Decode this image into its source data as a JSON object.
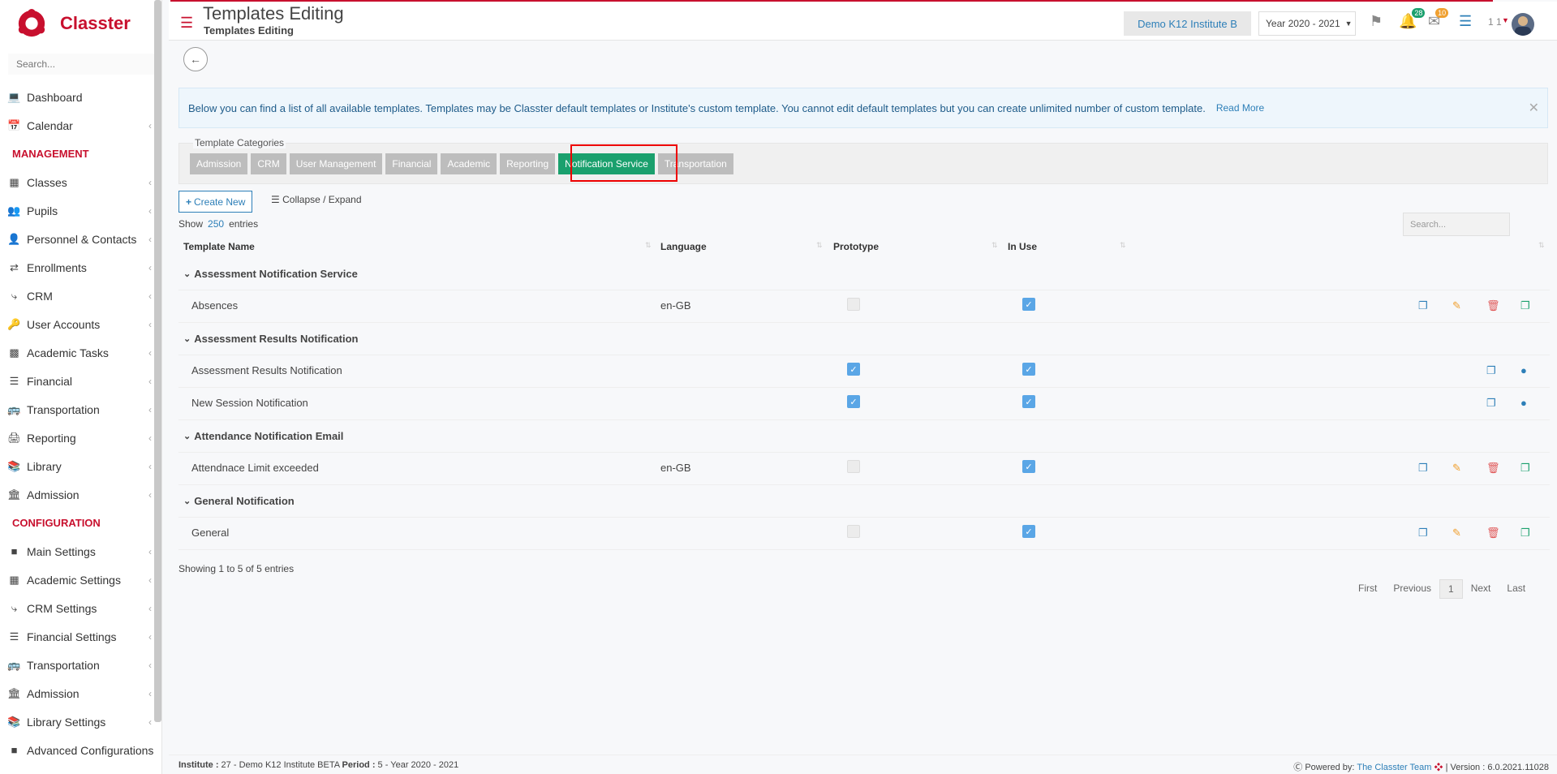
{
  "brand": "Classter",
  "sidebar": {
    "search_placeholder": "Search...",
    "items": [
      {
        "label": "Dashboard"
      },
      {
        "label": "Calendar"
      },
      {
        "label": "Classes"
      },
      {
        "label": "Pupils"
      },
      {
        "label": "Personnel & Contacts"
      },
      {
        "label": "Enrollments"
      },
      {
        "label": "CRM"
      },
      {
        "label": "User Accounts"
      },
      {
        "label": "Academic Tasks"
      },
      {
        "label": "Financial"
      },
      {
        "label": "Transportation"
      },
      {
        "label": "Reporting"
      },
      {
        "label": "Library"
      },
      {
        "label": "Admission"
      }
    ],
    "management_head": "MANAGEMENT",
    "configuration_head": "CONFIGURATION",
    "config_items": [
      {
        "label": "Main Settings"
      },
      {
        "label": "Academic Settings"
      },
      {
        "label": "CRM Settings"
      },
      {
        "label": "Financial Settings"
      },
      {
        "label": "Transportation"
      },
      {
        "label": "Admission"
      },
      {
        "label": "Library Settings"
      },
      {
        "label": "Advanced Configurations"
      }
    ]
  },
  "header": {
    "title": "Templates Editing",
    "subtitle": "Templates Editing",
    "institute": "Demo K12 Institute B",
    "year": "Year 2020 - 2021",
    "notif_count": "28",
    "mail_count": "10",
    "user_num": "1 1"
  },
  "info": {
    "text": "Below you can find a list of all available templates. Templates may be Classter default templates or Institute's custom template. You cannot edit default templates but you can create unlimited number of custom template.",
    "read_more": "Read More"
  },
  "categories": {
    "label": "Template Categories",
    "tabs": [
      "Admission",
      "CRM",
      "User Management",
      "Financial",
      "Academic",
      "Reporting",
      "Notification Service",
      "Transportation"
    ],
    "active": "Notification Service"
  },
  "actions": {
    "create": "Create New",
    "collapse": "Collapse / Expand",
    "show": "Show",
    "entries_count": "250",
    "entries": "entries",
    "search_placeholder": "Search..."
  },
  "table": {
    "headers": {
      "name": "Template Name",
      "language": "Language",
      "prototype": "Prototype",
      "in_use": "In Use"
    },
    "groups": [
      {
        "name": "Assessment Notification Service",
        "rows": [
          {
            "name": "Absences",
            "language": "en-GB",
            "prototype": false,
            "in_use": true,
            "type": "custom"
          }
        ]
      },
      {
        "name": "Assessment Results Notification",
        "rows": [
          {
            "name": "Assessment Results Notification",
            "language": "",
            "prototype": true,
            "in_use": true,
            "type": "default"
          },
          {
            "name": "New Session Notification",
            "language": "",
            "prototype": true,
            "in_use": true,
            "type": "default"
          }
        ]
      },
      {
        "name": "Attendance Notification Email",
        "rows": [
          {
            "name": "Attendnace Limit exceeded",
            "language": "en-GB",
            "prototype": false,
            "in_use": true,
            "type": "custom"
          }
        ]
      },
      {
        "name": "General Notification",
        "rows": [
          {
            "name": "General",
            "language": "",
            "prototype": false,
            "in_use": true,
            "type": "custom"
          }
        ]
      }
    ],
    "showing": "Showing 1 to 5 of 5 entries",
    "pager": {
      "first": "First",
      "previous": "Previous",
      "current": "1",
      "next": "Next",
      "last": "Last"
    }
  },
  "footer": {
    "institute_label": "Institute :",
    "institute_value": " 27 - Demo K12 Institute BETA ",
    "period_label": "Period :",
    "period_value": " 5 - Year 2020 - 2021",
    "powered": "Powered by: ",
    "team": "The Classter Team",
    "version": " | Version : 6.0.2021.11028"
  },
  "colors": {
    "brand": "#c8102e",
    "accent": "#2d7fb8",
    "active_tab": "#1aa06d"
  }
}
